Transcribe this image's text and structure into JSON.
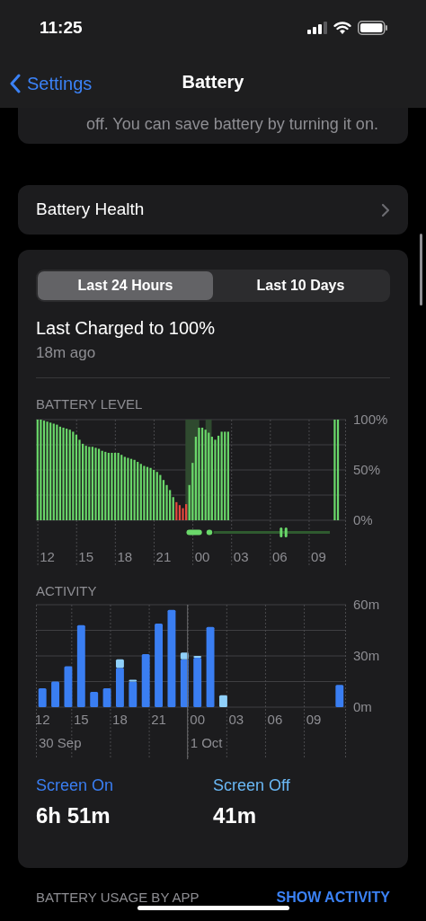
{
  "status_bar": {
    "time": "11:25"
  },
  "nav": {
    "back": "Settings",
    "title": "Battery"
  },
  "tip": {
    "text": "off. You can save battery by turning it on."
  },
  "health": {
    "label": "Battery Health"
  },
  "tabs": [
    {
      "label": "Last 24 Hours",
      "selected": true
    },
    {
      "label": "Last 10 Days",
      "selected": false
    }
  ],
  "last_charged": {
    "title": "Last Charged to 100%",
    "subtitle": "18m ago"
  },
  "battery_level": {
    "heading": "BATTERY LEVEL",
    "chart_data": {
      "type": "bar",
      "ylim": [
        0,
        100
      ],
      "categories": [
        null,
        null,
        null,
        "12",
        null,
        null,
        null,
        null,
        null,
        null,
        null,
        null,
        null,
        null,
        null,
        "15",
        null,
        null,
        null,
        null,
        null,
        null,
        null,
        null,
        null,
        null,
        null,
        "18",
        null,
        null,
        null,
        null,
        null,
        null,
        null,
        null,
        null,
        null,
        null,
        "21",
        null,
        null,
        null,
        null,
        null,
        null,
        null,
        null,
        null,
        null,
        null,
        "00",
        null,
        null,
        null,
        null,
        null,
        null,
        null,
        null,
        null,
        null,
        null,
        "03",
        null,
        null,
        null,
        null,
        null,
        null,
        null,
        null,
        null,
        null,
        null,
        "06",
        null,
        null,
        null,
        null,
        null,
        null,
        null,
        null,
        null,
        null,
        null,
        "09",
        null,
        null,
        null,
        null,
        null,
        null,
        null,
        null
      ],
      "yticks": [
        {
          "value": 0,
          "label": "0%"
        },
        {
          "value": 50,
          "label": "50%"
        },
        {
          "value": 100,
          "label": "100%"
        }
      ],
      "series": [
        {
          "color": "#6ad86a",
          "values": [
            100,
            100,
            99,
            98,
            97,
            96,
            95,
            93,
            92,
            91,
            90,
            88,
            85,
            80,
            76,
            74,
            73,
            73,
            72,
            71,
            69,
            68,
            67,
            67,
            67,
            67,
            65,
            63,
            62,
            61,
            60,
            58,
            56,
            54,
            53,
            52,
            50,
            48,
            45,
            40,
            35,
            30,
            23,
            null,
            null,
            null,
            null,
            35,
            57,
            83,
            92,
            92,
            90,
            87,
            83,
            80,
            84,
            88,
            88,
            88,
            null,
            null,
            null,
            null,
            null,
            null,
            null,
            null,
            null,
            null,
            null,
            null,
            null,
            null,
            null,
            null,
            null,
            null,
            null,
            null,
            null,
            null,
            null,
            null,
            null,
            null,
            null,
            null,
            null,
            null,
            null,
            null,
            100,
            100,
            null,
            null
          ]
        },
        {
          "color": "#e5483e",
          "values": [
            null,
            null,
            null,
            null,
            null,
            null,
            null,
            null,
            null,
            null,
            null,
            null,
            null,
            null,
            null,
            null,
            null,
            null,
            null,
            null,
            null,
            null,
            null,
            null,
            null,
            null,
            null,
            null,
            null,
            null,
            null,
            null,
            null,
            null,
            null,
            null,
            null,
            null,
            null,
            null,
            null,
            null,
            null,
            18,
            15,
            12,
            16,
            null,
            null,
            null,
            null,
            null,
            null,
            null,
            null,
            null,
            null,
            null,
            null,
            null,
            null,
            null,
            null,
            null,
            null,
            null,
            null,
            null,
            null,
            null,
            null,
            null,
            null,
            null,
            null,
            null,
            null,
            null,
            null,
            null,
            null,
            null,
            null,
            null,
            null,
            null,
            null,
            null,
            null,
            null,
            null,
            null,
            null,
            null,
            null,
            null
          ]
        }
      ]
    }
  },
  "activity": {
    "heading": "ACTIVITY",
    "chart_data": {
      "type": "bar",
      "stacked": true,
      "ylim": [
        0,
        60
      ],
      "categories": [
        "12",
        null,
        null,
        "15",
        null,
        null,
        "18",
        null,
        null,
        "21",
        null,
        null,
        "00",
        null,
        null,
        "03",
        null,
        null,
        "06",
        null,
        null,
        "09",
        null,
        null
      ],
      "yticks": [
        {
          "value": 0,
          "label": "0m"
        },
        {
          "value": 30,
          "label": "30m"
        },
        {
          "value": 60,
          "label": "60m"
        }
      ],
      "annotations": [
        "30 Sep",
        "1 Oct"
      ],
      "series": [
        {
          "color": "#3a7ef2",
          "values": [
            11,
            15,
            24,
            48,
            9,
            11,
            23,
            15,
            31,
            49,
            57,
            28,
            29,
            47,
            null,
            null,
            null,
            null,
            null,
            null,
            null,
            null,
            null,
            13
          ]
        },
        {
          "color": "#8fd0fa",
          "values": [
            null,
            null,
            null,
            null,
            null,
            null,
            5,
            1,
            null,
            null,
            null,
            4,
            1,
            null,
            7,
            null,
            null,
            null,
            null,
            null,
            null,
            null,
            null,
            null
          ]
        }
      ]
    }
  },
  "totals": [
    {
      "label": "Screen On",
      "value": "6h 51m",
      "color": "#3a7ef2"
    },
    {
      "label": "Screen Off",
      "value": "41m",
      "color": "#6ab8f5"
    }
  ],
  "usage": {
    "heading": "BATTERY USAGE BY APP",
    "action": "SHOW ACTIVITY"
  }
}
